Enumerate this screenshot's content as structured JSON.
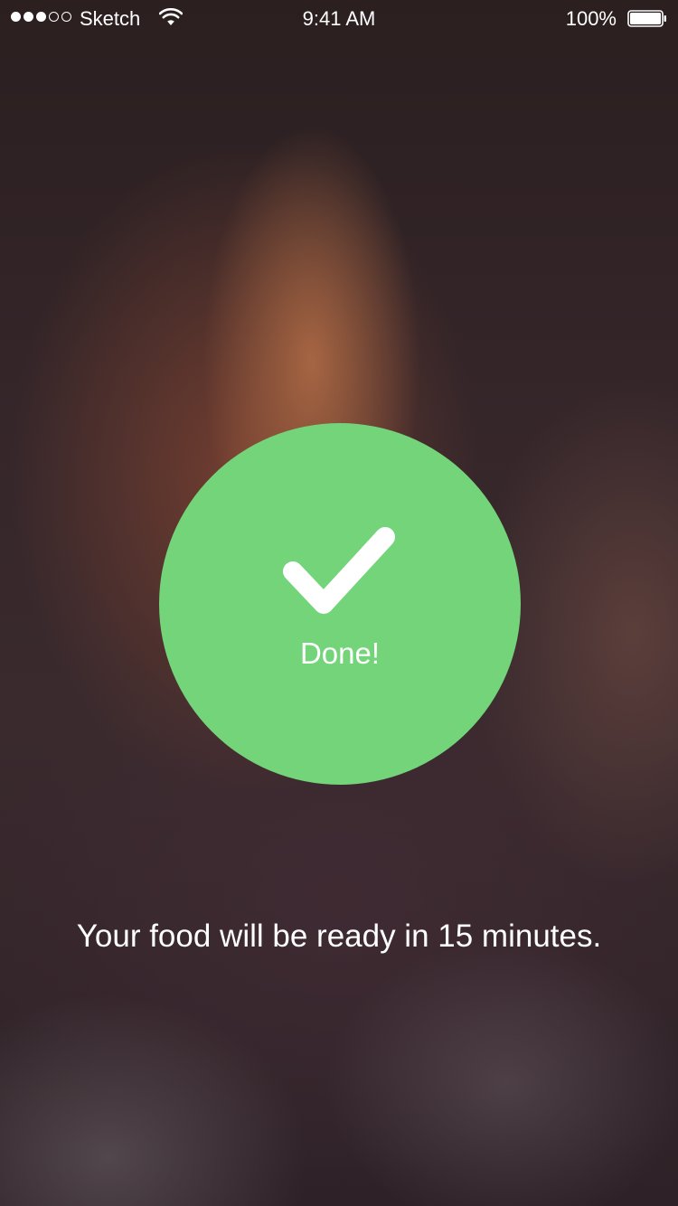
{
  "status_bar": {
    "signal_strength": "3 of 5",
    "carrier": "Sketch",
    "time": "9:41 AM",
    "battery_percent": "100%",
    "battery_level": 1.0,
    "icons": [
      "signal-dots-icon",
      "wifi-icon",
      "battery-icon"
    ]
  },
  "confirmation": {
    "icon": "checkmark-icon",
    "label": "Done!",
    "color": "#73d47a"
  },
  "message": "Your food will be ready in 15 minutes."
}
